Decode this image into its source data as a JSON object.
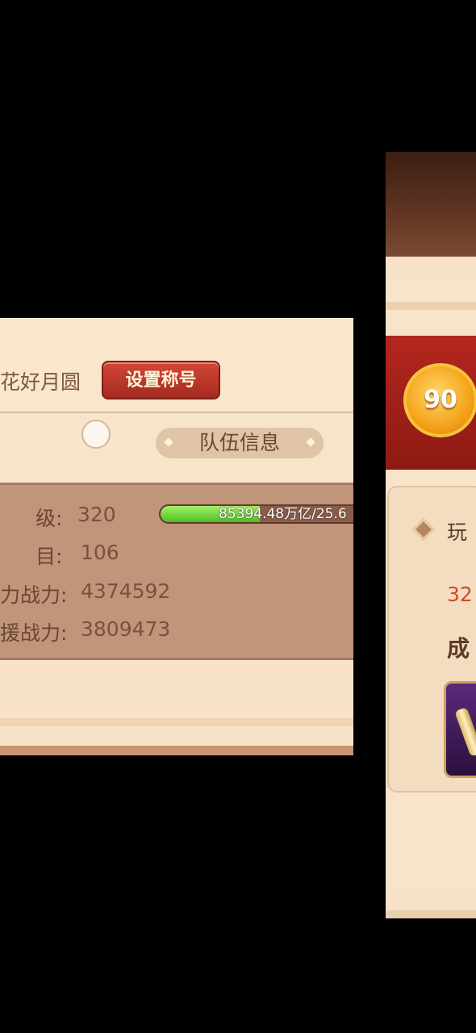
{
  "left_panel": {
    "title_text": "花好月圆",
    "set_title_button": "设置称号",
    "team_info_button": "队伍信息",
    "stats": {
      "level_label": "级:",
      "level_value": "320",
      "exp_text": "85394.48万亿/25.6",
      "exp_progress": 0.48,
      "count_label": "目:",
      "count_value": "106",
      "power_label": "力战力:",
      "power_value": "4374592",
      "support_label": "援战力:",
      "support_value": "3809473"
    }
  },
  "right_panel": {
    "level_badge": "90",
    "label_player": "玩",
    "number": "32",
    "label_cheng": "成"
  }
}
